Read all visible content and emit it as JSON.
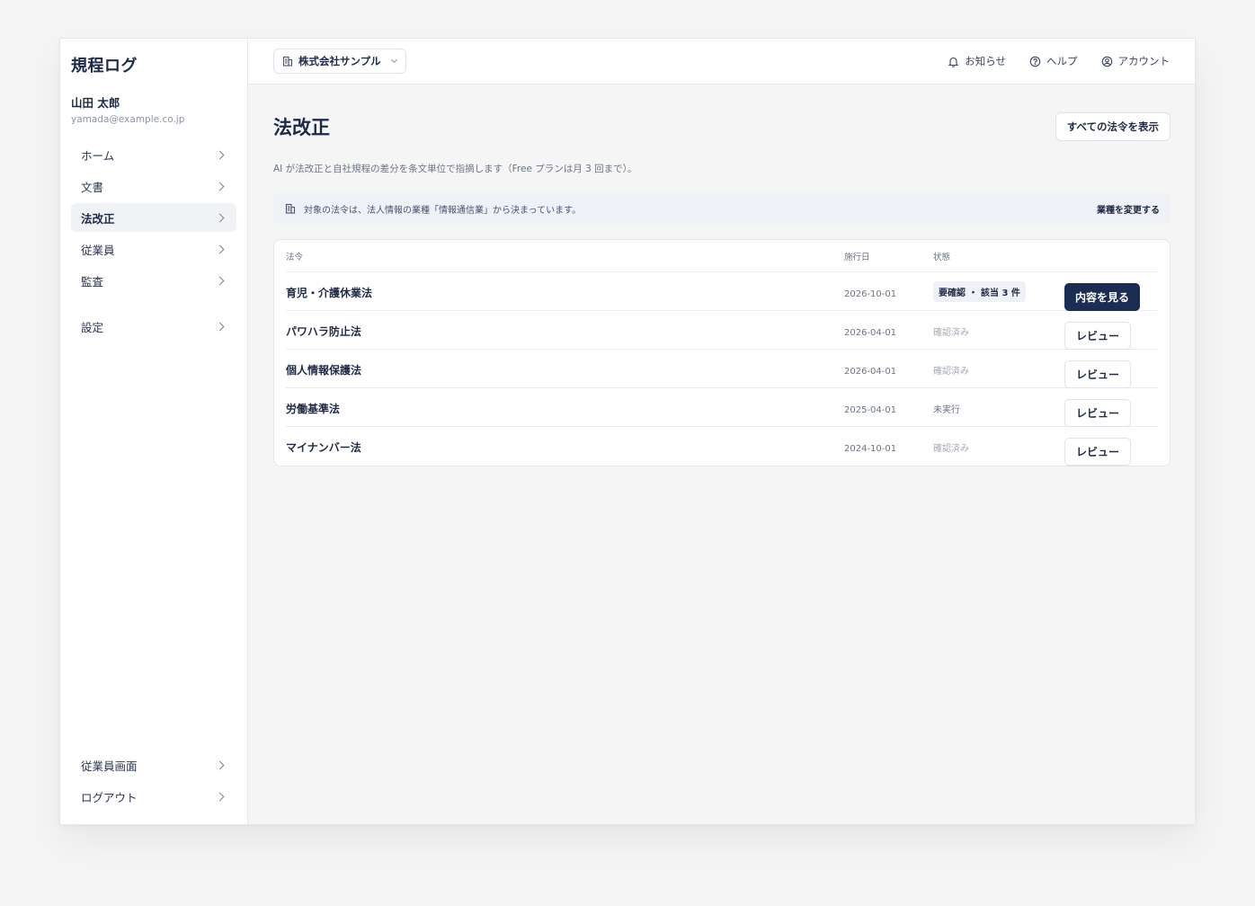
{
  "app": {
    "brand": "規程ログ"
  },
  "user": {
    "name": "山田 太郎",
    "email": "yamada@example.co.jp"
  },
  "sidebar": {
    "items": [
      {
        "label": "ホーム",
        "active": false
      },
      {
        "label": "文書",
        "active": false
      },
      {
        "label": "法改正",
        "active": true
      },
      {
        "label": "従業員",
        "active": false
      },
      {
        "label": "監査",
        "active": false
      }
    ],
    "settings_label": "設定",
    "bottom_items": [
      {
        "label": "従業員画面"
      },
      {
        "label": "ログアウト"
      }
    ]
  },
  "topbar": {
    "org_name": "株式会社サンプル",
    "notifications_label": "お知らせ",
    "help_label": "ヘルプ",
    "account_label": "アカウント"
  },
  "main": {
    "page_title": "法改正",
    "view_all_button": "すべての法令を表示",
    "description": "AI が法改正と自社規程の差分を条文単位で指摘します（Free プランは月 3 回まで）。",
    "notice": {
      "text": "対象の法令は、法人情報の業種「情報通信業」から決まっています。",
      "link": "業種を変更する"
    },
    "table": {
      "headers": {
        "law": "法令",
        "date": "施行日",
        "status": "状態"
      },
      "rows": [
        {
          "law": "育児・介護休業法",
          "date": "2026-10-01",
          "status": "要確認 ・ 該当 3 件",
          "action": "内容を見る"
        },
        {
          "law": "パワハラ防止法",
          "date": "2026-04-01",
          "status": "確認済み",
          "action": "レビュー"
        },
        {
          "law": "個人情報保護法",
          "date": "2026-04-01",
          "status": "確認済み",
          "action": "レビュー"
        },
        {
          "law": "労働基準法",
          "date": "2025-04-01",
          "status": "未実行",
          "action": "レビュー"
        },
        {
          "law": "マイナンバー法",
          "date": "2024-10-01",
          "status": "確認済み",
          "action": "レビュー"
        }
      ]
    }
  },
  "colors": {
    "primary": "#1b2d52",
    "background": "#f5f5f5",
    "notice_bg": "#eef1f5"
  }
}
